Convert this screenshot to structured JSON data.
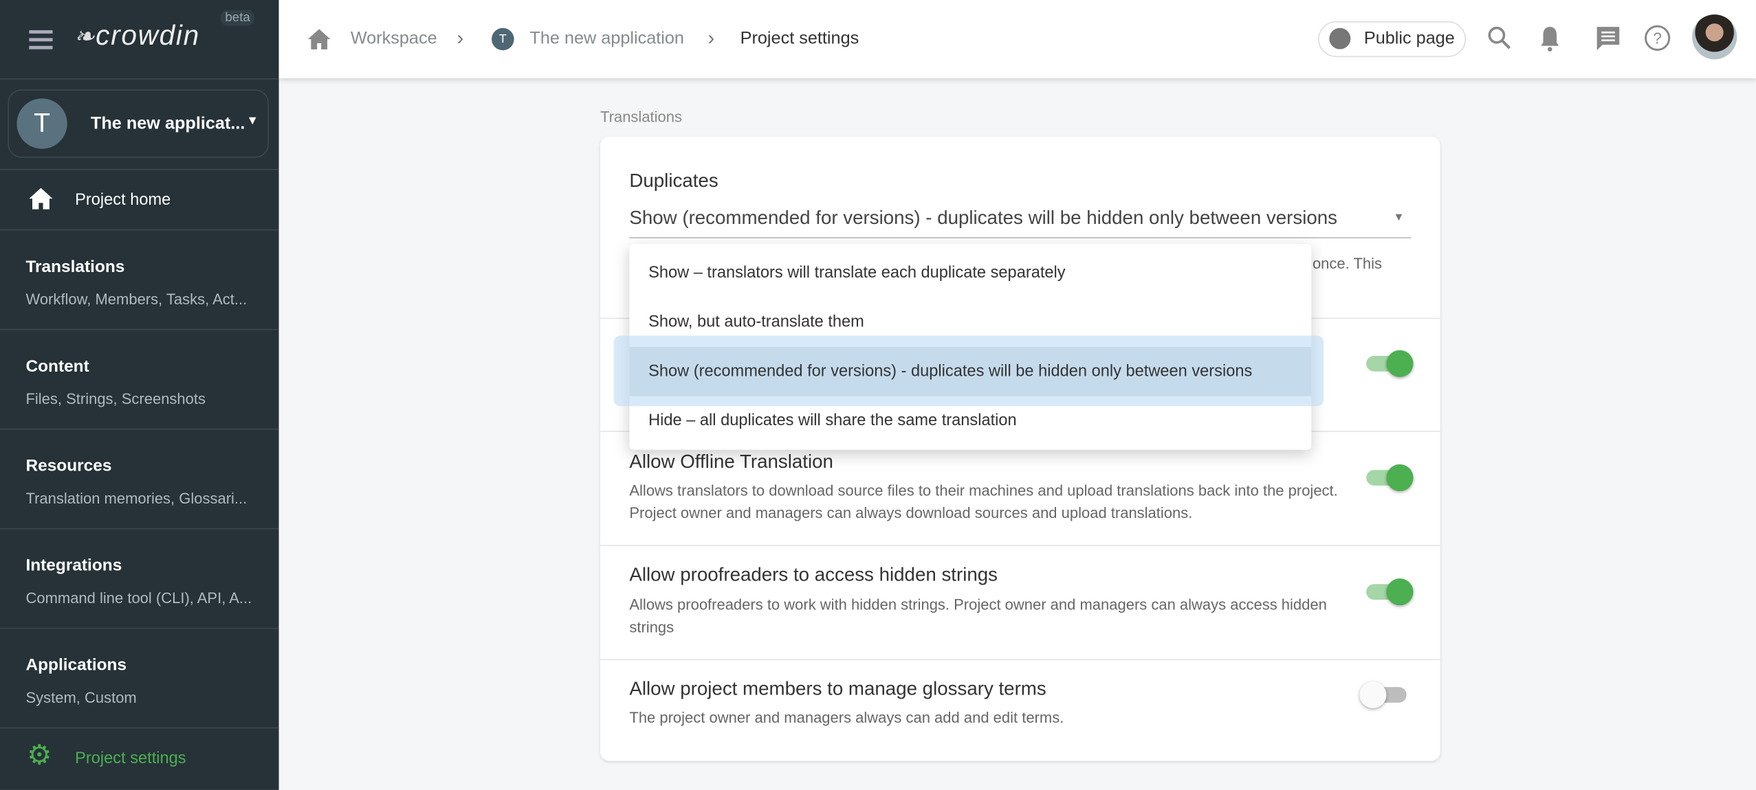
{
  "brand": {
    "logo": "crowdin",
    "badge": "beta"
  },
  "sidebar": {
    "project": {
      "initial": "T",
      "name": "The new applicat..."
    },
    "home": "Project home",
    "sections": [
      {
        "title": "Translations",
        "sub": "Workflow, Members, Tasks, Act..."
      },
      {
        "title": "Content",
        "sub": "Files, Strings, Screenshots"
      },
      {
        "title": "Resources",
        "sub": "Translation memories, Glossari..."
      },
      {
        "title": "Integrations",
        "sub": "Command line tool (CLI), API, A..."
      },
      {
        "title": "Applications",
        "sub": "System, Custom"
      }
    ],
    "settings": "Project settings"
  },
  "breadcrumb": {
    "workspace": "Workspace",
    "project_initial": "T",
    "project": "The new application",
    "current": "Project settings"
  },
  "header": {
    "public_page": "Public page"
  },
  "section_label": "Translations",
  "duplicates": {
    "label": "Duplicates",
    "value": "Show (recommended for versions) - duplicates will be hidden only between versions",
    "hint_fragment": "once. This",
    "options": [
      "Show – translators will translate each duplicate separately",
      "Show, but auto-translate them",
      "Show (recommended for versions) - duplicates will be hidden only between versions",
      "Hide – all duplicates will share the same translation"
    ],
    "selected_index": 2
  },
  "settings": [
    {
      "title": "Allow Offline Translation",
      "desc": "Allows translators to download source files to their machines and upload translations back into the project. Project owner and managers can always download sources and upload translations.",
      "enabled": true
    },
    {
      "title": "Allow proofreaders to access hidden strings",
      "desc": "Allows proofreaders to work with hidden strings. Project owner and managers can always access hidden strings",
      "enabled": true
    },
    {
      "title": "Allow project members to manage glossary terms",
      "desc": "The project owner and managers always can add and edit terms.",
      "enabled": false
    }
  ],
  "colors": {
    "sidebar": "#263238",
    "accent": "#4caf50",
    "highlight": "#c5dbec"
  }
}
